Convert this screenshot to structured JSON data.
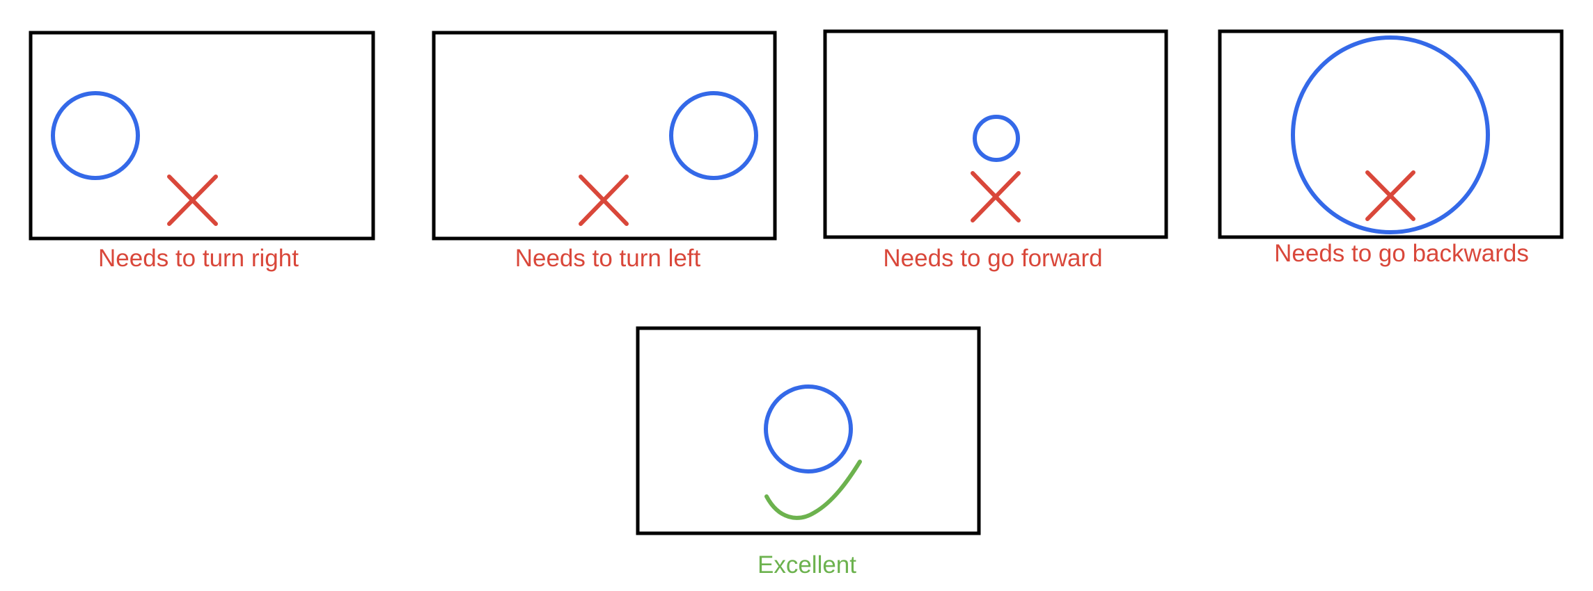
{
  "colors": {
    "frame": "#000000",
    "target": "#3469e8",
    "wrong": "#d9473a",
    "correct": "#6cb24e"
  },
  "panels": [
    {
      "id": "turn-right",
      "caption": "Needs to turn right",
      "status": "wrong",
      "icons": [
        "circle-icon",
        "cross-icon"
      ]
    },
    {
      "id": "turn-left",
      "caption": "Needs to turn left",
      "status": "wrong",
      "icons": [
        "circle-icon",
        "cross-icon"
      ]
    },
    {
      "id": "go-forward",
      "caption": "Needs to go forward",
      "status": "wrong",
      "icons": [
        "circle-icon",
        "cross-icon"
      ]
    },
    {
      "id": "go-backwards",
      "caption": "Needs to go backwards",
      "status": "wrong",
      "icons": [
        "circle-icon",
        "cross-icon"
      ]
    },
    {
      "id": "excellent",
      "caption": "Excellent",
      "status": "correct",
      "icons": [
        "circle-icon",
        "checkmark-icon"
      ]
    }
  ]
}
